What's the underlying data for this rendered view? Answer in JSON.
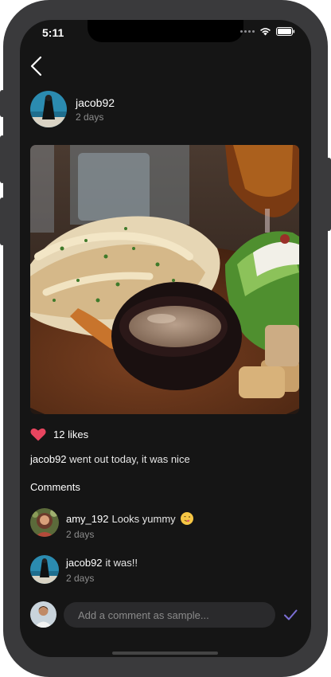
{
  "status_bar": {
    "time": "5:11"
  },
  "post": {
    "username": "jacob92",
    "time": "2 days",
    "likes": "12 likes",
    "caption_user": "jacob92",
    "caption_text": "went out today, it was nice"
  },
  "comments_section": {
    "title": "Comments",
    "items": [
      {
        "user": "amy_192",
        "text": "Looks yummy",
        "time": "2 days"
      },
      {
        "user": "jacob92",
        "text": "it was!!",
        "time": "2 days"
      }
    ]
  },
  "composer": {
    "placeholder": "Add a comment as sample..."
  },
  "colors": {
    "background": "#151515",
    "heart": "#e8455f",
    "accent": "#7c6fd6",
    "input": "#2a2a2c"
  },
  "icons": [
    "back-chevron-icon",
    "heart-icon",
    "check-icon",
    "wifi-icon",
    "battery-icon",
    "smiley-emoji-icon"
  ]
}
